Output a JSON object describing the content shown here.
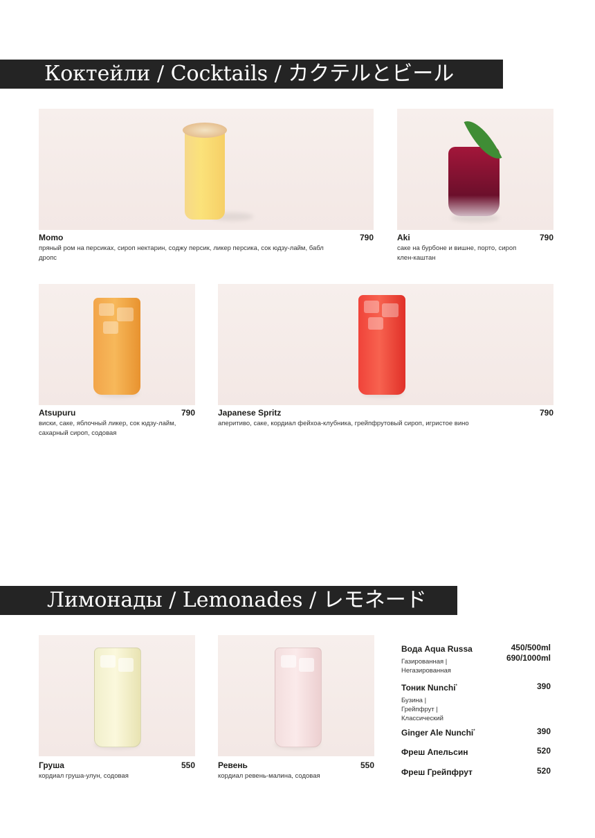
{
  "sections": {
    "cocktails_title": "Коктейли / Cocktails / カクテルとビール",
    "lemonades_title": "Лимонады / Lemonades / レモネード"
  },
  "cocktails": [
    {
      "name": "Momo",
      "price": "790",
      "desc": "пряный ром на персиках, сироп нектарин, соджу персик, ликер персика, сок юдзу-лайм, бабл дропс"
    },
    {
      "name": "Aki",
      "price": "790",
      "desc": "саке на бурбоне и вишне, порто, сироп клен-каштан"
    },
    {
      "name": "Atsupuru",
      "price": "790",
      "desc": "виски, саке, яблочный ликер, сок юдзу-лайм, сахарный сироп, содовая"
    },
    {
      "name": "Japanese Spritz",
      "price": "790",
      "desc": "аперитиво, саке, кордиал фейхоа-клубника, грейпфрутовый сироп, игристое вино"
    }
  ],
  "lemonades": [
    {
      "name": "Груша",
      "price": "550",
      "desc": "кордиал груша-улун, содовая"
    },
    {
      "name": "Ревень",
      "price": "550",
      "desc": "кордиал ревень-малина, содовая"
    }
  ],
  "drinks": [
    {
      "name": "Вода Aqua Russa",
      "price": "450/500ml",
      "price2": "690/1000ml",
      "options": [
        "Газированная |",
        "Негазированная"
      ]
    },
    {
      "name": "Тоник Nunchi",
      "mark": "*",
      "price": "390",
      "options": [
        "Бузина |",
        "Грейпфрут |",
        "Классический"
      ]
    },
    {
      "name": "Ginger Ale Nunchi",
      "mark": "*",
      "price": "390"
    },
    {
      "name": "Фреш Апельсин",
      "price": "520"
    },
    {
      "name": "Фреш Грейпфрут",
      "price": "520"
    }
  ]
}
